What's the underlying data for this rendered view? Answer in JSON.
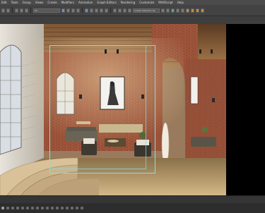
{
  "menu": {
    "items": [
      "Edit",
      "Tools",
      "Group",
      "Views",
      "Create",
      "Modifiers",
      "Animation",
      "Graph Editors",
      "Rendering",
      "Customize",
      "MAXScript",
      "Help"
    ]
  },
  "toolbar": {
    "selection_filter": "All",
    "named_selection_set": "Create Selection Se"
  },
  "viewport": {
    "label": "",
    "safe_frame_color": "#7fe2e2"
  },
  "colors": {
    "ui_bg": "#3a3a3a",
    "right_panel": "#000000",
    "accent_blue": "#6d93c2"
  }
}
